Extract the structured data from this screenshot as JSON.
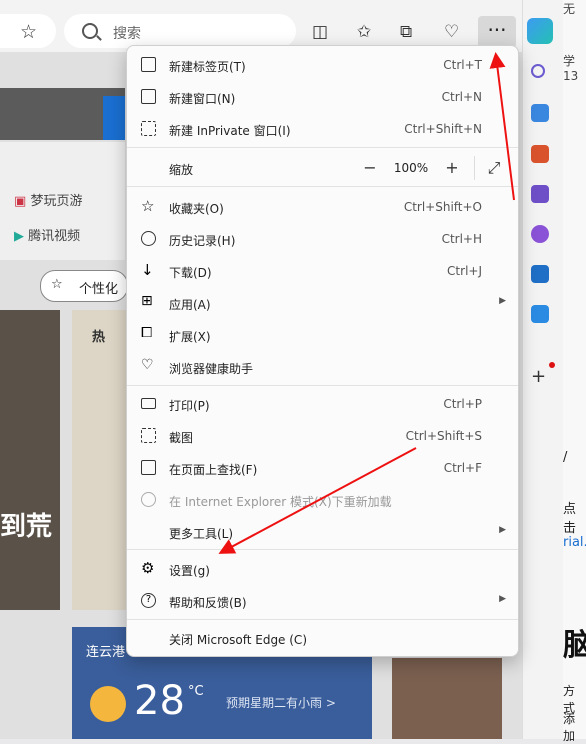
{
  "toolbar": {
    "search_placeholder": "搜索",
    "more_button": "···"
  },
  "page": {
    "favorites": [
      "梦玩页游",
      "腾讯视频"
    ],
    "personalize_button": "个性化",
    "hot_label": "热",
    "headline_fragment": "到荒",
    "weather": {
      "title": "连云港",
      "temperature": "28",
      "unit": "°C",
      "forecast": "预期星期二有小雨 >"
    }
  },
  "menu": {
    "items": [
      {
        "label": "新建标签页(T)",
        "shortcut": "Ctrl+T",
        "icon": "new-tab-icon"
      },
      {
        "label": "新建窗口(N)",
        "shortcut": "Ctrl+N",
        "icon": "new-window-icon"
      },
      {
        "label": "新建 InPrivate 窗口(I)",
        "shortcut": "Ctrl+Shift+N",
        "icon": "inprivate-icon"
      },
      {
        "label": "缩放",
        "zoom_value": "100%",
        "icon": ""
      },
      {
        "label": "收藏夹(O)",
        "shortcut": "Ctrl+Shift+O",
        "icon": "favorites-icon"
      },
      {
        "label": "历史记录(H)",
        "shortcut": "Ctrl+H",
        "icon": "history-icon"
      },
      {
        "label": "下载(D)",
        "shortcut": "Ctrl+J",
        "icon": "download-icon"
      },
      {
        "label": "应用(A)",
        "shortcut": "",
        "icon": "apps-icon",
        "submenu": true
      },
      {
        "label": "扩展(X)",
        "shortcut": "",
        "icon": "extensions-icon"
      },
      {
        "label": "浏览器健康助手",
        "shortcut": "",
        "icon": "health-icon"
      },
      {
        "label": "打印(P)",
        "shortcut": "Ctrl+P",
        "icon": "print-icon"
      },
      {
        "label": "截图",
        "shortcut": "Ctrl+Shift+S",
        "icon": "screenshot-icon"
      },
      {
        "label": "在页面上查找(F)",
        "shortcut": "Ctrl+F",
        "icon": "find-icon"
      },
      {
        "label": "在 Internet Explorer 模式(X)下重新加载",
        "shortcut": "",
        "icon": "ie-icon",
        "disabled": true
      },
      {
        "label": "更多工具(L)",
        "shortcut": "",
        "icon": "",
        "submenu": true
      },
      {
        "label": "设置(g)",
        "shortcut": "",
        "icon": "settings-icon"
      },
      {
        "label": "帮助和反馈(B)",
        "shortcut": "",
        "icon": "help-icon",
        "submenu": true
      },
      {
        "label": "关闭 Microsoft Edge (C)",
        "shortcut": "",
        "icon": ""
      }
    ]
  },
  "right_strip": {
    "fragments": [
      "无",
      "学 13",
      "/",
      "点击",
      "rial.",
      "脑",
      "方式",
      "添加"
    ]
  },
  "colors": {
    "accent": "#1a6fd1",
    "annotation_arrow": "#e11111"
  }
}
